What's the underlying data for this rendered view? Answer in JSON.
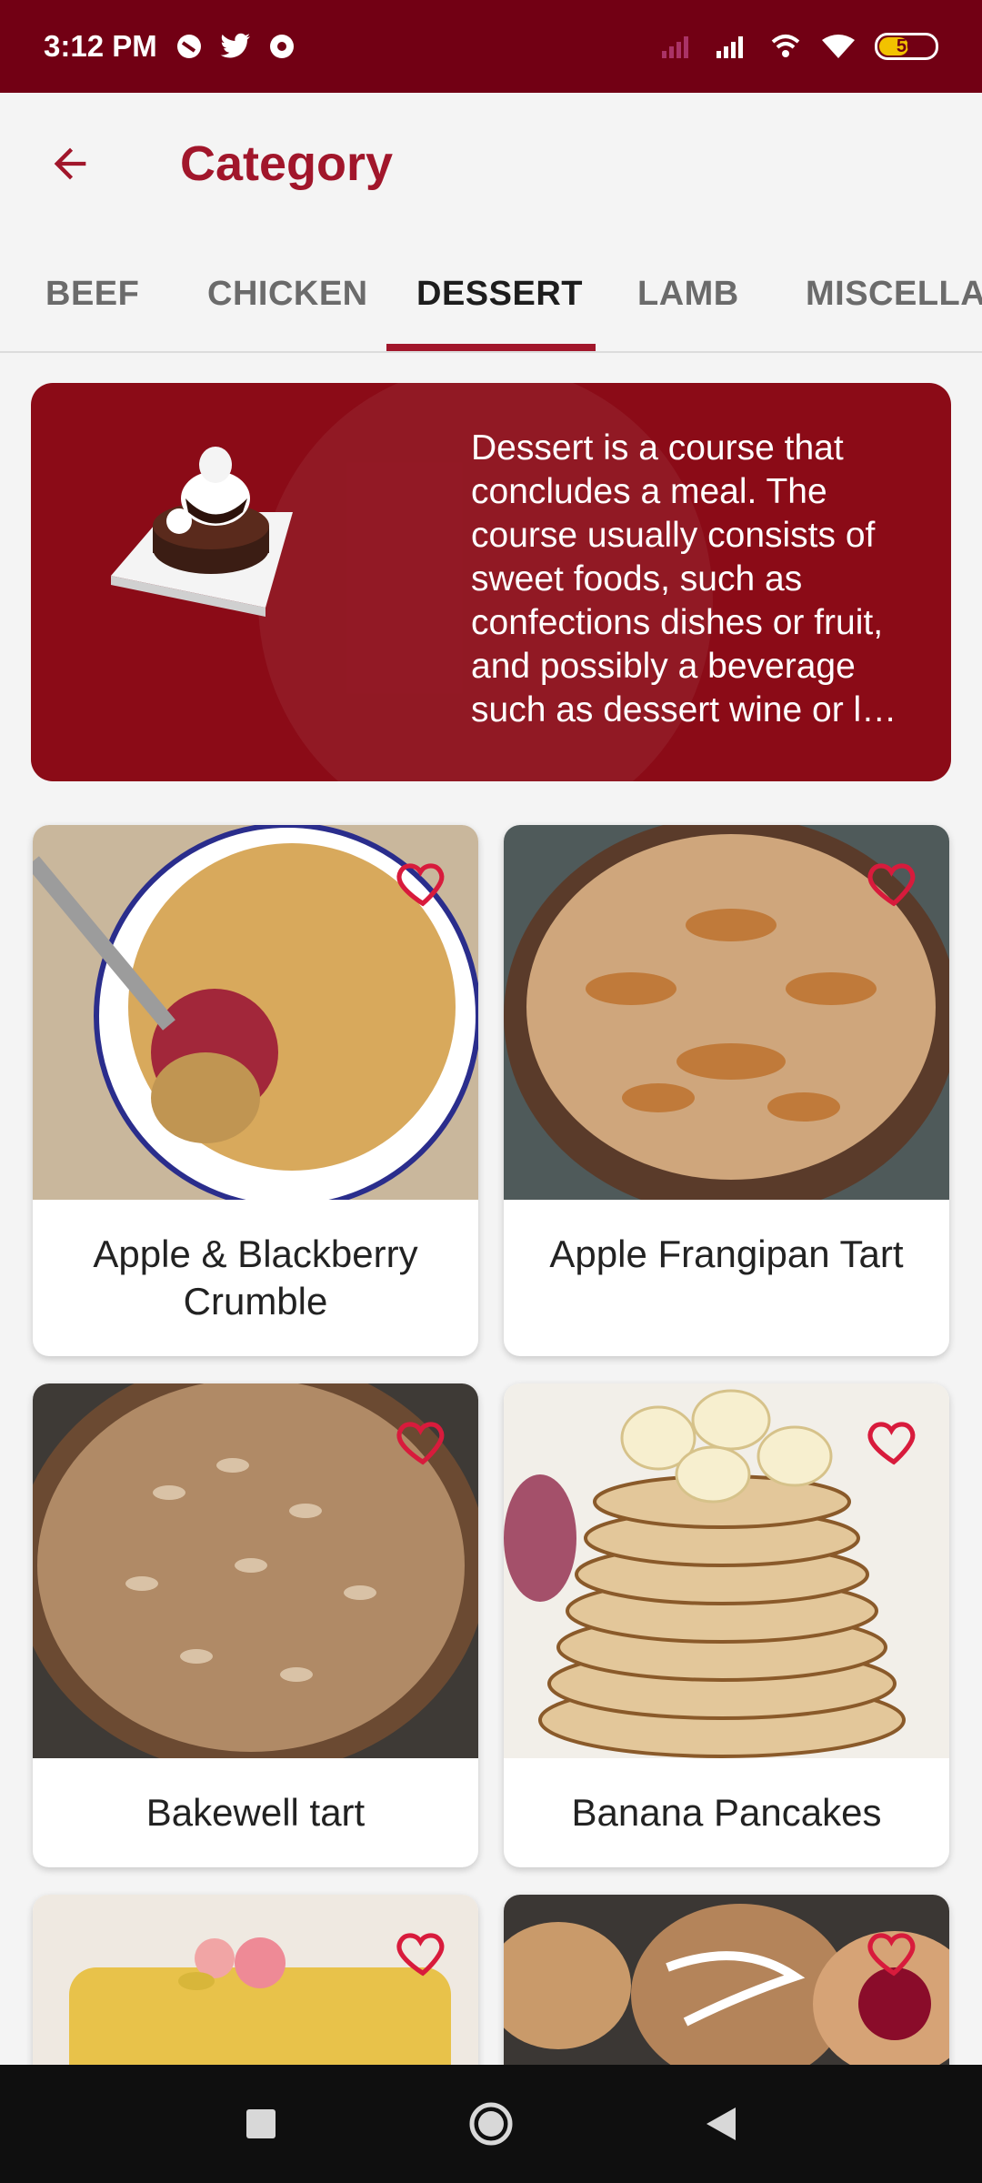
{
  "status": {
    "time": "3:12 PM",
    "battery": 50
  },
  "app_bar": {
    "title": "Category"
  },
  "tabs": [
    {
      "label": "BEEF"
    },
    {
      "label": "CHICKEN"
    },
    {
      "label": "DESSERT"
    },
    {
      "label": "LAMB"
    },
    {
      "label": "MISCELLAN"
    }
  ],
  "banner": {
    "text": "Dessert is a course that concludes a meal. The course usually consists of sweet foods, such as confections dishes or fruit, and possibly a beverage such as dessert wine or l…"
  },
  "meals": [
    {
      "name": "Apple & Blackberry Crumble"
    },
    {
      "name": "Apple Frangipan Tart"
    },
    {
      "name": "Bakewell tart"
    },
    {
      "name": "Banana Pancakes"
    },
    {
      "name": ""
    },
    {
      "name": ""
    }
  ],
  "colors": {
    "brand": "#a1162b",
    "status_bar": "#720014",
    "banner": "#8b0b17"
  }
}
